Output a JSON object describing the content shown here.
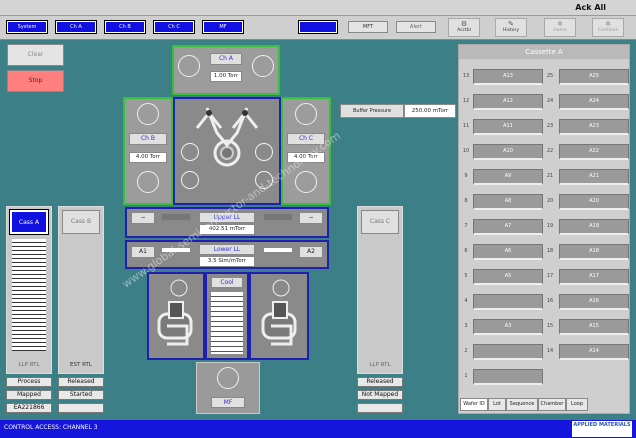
{
  "header": {
    "title": "Ack All"
  },
  "nav": {
    "buttons": [
      "System",
      "Ch A",
      "Ch B",
      "Ch C",
      "MF"
    ],
    "selected_grey": "",
    "mf_label": "MFT",
    "alert_label": "Alert"
  },
  "toolbar": [
    {
      "label": "Acctbl",
      "icon": "wrench-icon"
    },
    {
      "label": "History",
      "icon": "brush-icon"
    },
    {
      "label": "Home",
      "icon": "gear-icon"
    },
    {
      "label": "Continue",
      "icon": "gear-icon"
    }
  ],
  "left_panel": {
    "clear_label": "Clear",
    "stop_label": "Stop"
  },
  "chambers": {
    "a": {
      "label": "Ch A",
      "value": "1.00 Torr"
    },
    "b": {
      "label": "Ch B",
      "value": "4.00 Torr"
    },
    "c": {
      "label": "Ch C",
      "value": "4.00 Torr"
    },
    "buffer": {
      "label": "Buffer Pressure",
      "value": "250.00 mTorr"
    }
  },
  "loadlocks": {
    "upper": {
      "label": "Upper LL",
      "value": "402.51 mTorr",
      "left": "−",
      "right": "−"
    },
    "lower": {
      "label": "Lower LL",
      "value": "3.5 Slm/mTorr",
      "left": "A1",
      "right": "A2"
    },
    "cool": {
      "label": "Cool"
    },
    "mf": {
      "label": "MF"
    }
  },
  "cassettes": {
    "a": {
      "label": "Cass A",
      "footer": "LLP RTL",
      "status": [
        "Process",
        "Mapped",
        "EA221866"
      ]
    },
    "b": {
      "label": "Cass B",
      "footer": "EST RTL",
      "status": [
        "Released",
        "Started",
        ""
      ]
    },
    "c": {
      "label": "Cass C",
      "footer": "LLP RTL",
      "status": [
        "Released",
        "Not Mapped",
        ""
      ]
    }
  },
  "cassette_a": {
    "title": "Cassette A",
    "left_col": [
      {
        "num": "13",
        "label": "A13"
      },
      {
        "num": "12",
        "label": "A12"
      },
      {
        "num": "11",
        "label": "A11"
      },
      {
        "num": "10",
        "label": "A10"
      },
      {
        "num": "9",
        "label": "A9"
      },
      {
        "num": "8",
        "label": "A8"
      },
      {
        "num": "7",
        "label": "A7"
      },
      {
        "num": "6",
        "label": "A6"
      },
      {
        "num": "5",
        "label": "A5"
      },
      {
        "num": "4",
        "label": ""
      },
      {
        "num": "3",
        "label": "A3"
      },
      {
        "num": "2",
        "label": ""
      },
      {
        "num": "1",
        "label": ""
      }
    ],
    "right_col": [
      {
        "num": "25",
        "label": "A25"
      },
      {
        "num": "24",
        "label": "A24"
      },
      {
        "num": "23",
        "label": "A23"
      },
      {
        "num": "22",
        "label": "A22"
      },
      {
        "num": "21",
        "label": "A21"
      },
      {
        "num": "20",
        "label": "A20"
      },
      {
        "num": "19",
        "label": "A19"
      },
      {
        "num": "18",
        "label": "A18"
      },
      {
        "num": "17",
        "label": "A17"
      },
      {
        "num": "16",
        "label": "A16"
      },
      {
        "num": "15",
        "label": "A15"
      },
      {
        "num": "14",
        "label": "A14"
      }
    ],
    "tabs": [
      "Wafer ID",
      "Lot",
      "Sequence",
      "Chamber",
      "Loop"
    ]
  },
  "statusbar": {
    "text": "CONTROL ACCESS: CHANNEL 3",
    "logo": "APPLIED MATERIALS"
  },
  "watermark": "www.global-semiconductor-and-technology.com"
}
